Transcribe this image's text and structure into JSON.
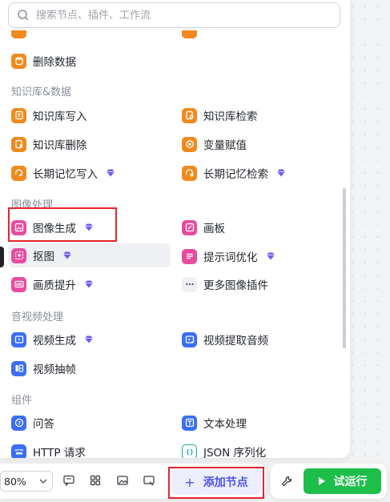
{
  "search": {
    "placeholder": "搜索节点、插件、工作流"
  },
  "sections": {
    "knowledge": "知识库&数据",
    "image": "图像处理",
    "video": "音视频处理",
    "component": "组件"
  },
  "items": {
    "delete_data": "删除数据",
    "kb_write": "知识库写入",
    "kb_search": "知识库检索",
    "kb_delete": "知识库删除",
    "var_assign": "变量赋值",
    "ltm_write": "长期记忆写入",
    "ltm_search": "长期记忆检索",
    "image_gen": "图像生成",
    "canvas": "画板",
    "cutout": "抠图",
    "prompt_opt": "提示词优化",
    "quality_up": "画质提升",
    "more_image": "更多图像插件",
    "video_gen": "视频生成",
    "video_audio": "视频提取音频",
    "video_frame": "视频抽帧",
    "qa": "问答",
    "text_proc": "文本处理",
    "http": "HTTP 请求",
    "json_ser": "JSON 序列化"
  },
  "toolbar": {
    "zoom": "80%",
    "add_node": "添加节点",
    "run": "试运行"
  },
  "colors": {
    "accent": "#4d53e8",
    "run_green": "#1dbf4a",
    "highlight_red": "#e8242b",
    "orange_icon": "#f08a1e",
    "pink_icon": "#e84b9e",
    "blue_icon": "#3b6ef5"
  }
}
